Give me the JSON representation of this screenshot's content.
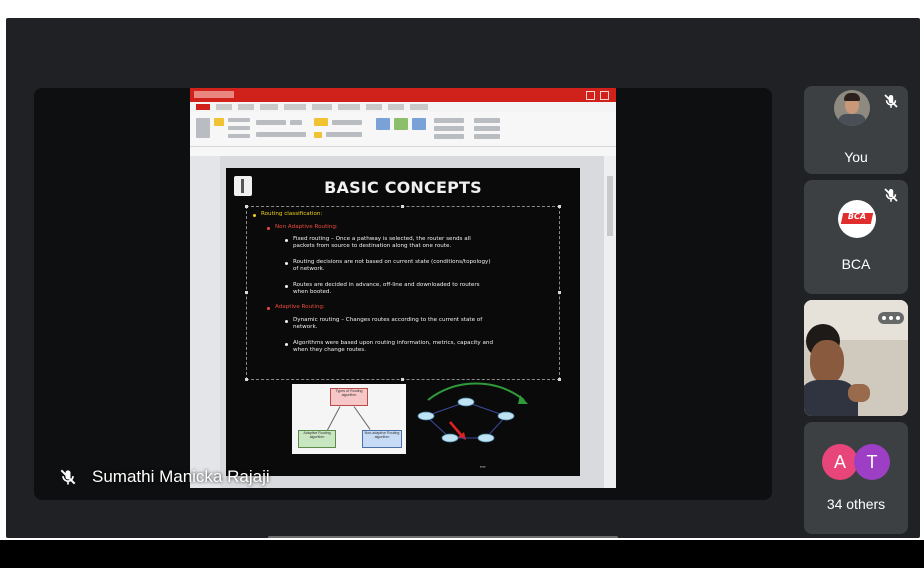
{
  "presenter": {
    "name": "Sumathi Manicka Rajaji"
  },
  "slide": {
    "title": "BASIC CONCEPTS",
    "heading": "Routing classification:",
    "non_adaptive": {
      "label": "Non Adaptive Routing:",
      "points": [
        {
          "lines": [
            "Fixed routing – Once a pathway is selected, the router sends all",
            "packets from source to destination along that one route."
          ]
        },
        {
          "lines": [
            "Routing decisions are not based on current state (conditions/topology)",
            "of network."
          ]
        },
        {
          "lines": [
            "Routes are decided in advance, off-line and downloaded to routers",
            "when booted."
          ]
        }
      ]
    },
    "adaptive": {
      "label": "Adaptive Routing:",
      "points": [
        {
          "lines": [
            "Dynamic routing – Changes routes according to the current state of",
            "network."
          ]
        },
        {
          "lines": [
            "Algorithms were based upon routing information, metrics, capacity and",
            "when they change routes."
          ]
        }
      ]
    },
    "diagram": {
      "top": "Types of Routing algorithm",
      "left": "Adaptive Routing algorithm",
      "right": "Non-adaptive Routing algorithm"
    }
  },
  "participants": {
    "you_label": "You",
    "bca_label": "BCA",
    "bca_logo_text": "BCA",
    "others_count_label": "34 others",
    "others_avatars": [
      {
        "letter": "A",
        "color": "#e8457a"
      },
      {
        "letter": "T",
        "color": "#9c3fc5"
      }
    ]
  },
  "colors": {
    "meet_background": "#202124",
    "tile_background": "#3c4043",
    "ppt_red": "#d0221a",
    "slide_yellow": "#f2d21b",
    "slide_red": "#ef4b3c",
    "slide_blue": "#5c6fe0"
  },
  "icons": {
    "mic_off": "mic-off-icon",
    "more_options": "more-options-icon"
  }
}
